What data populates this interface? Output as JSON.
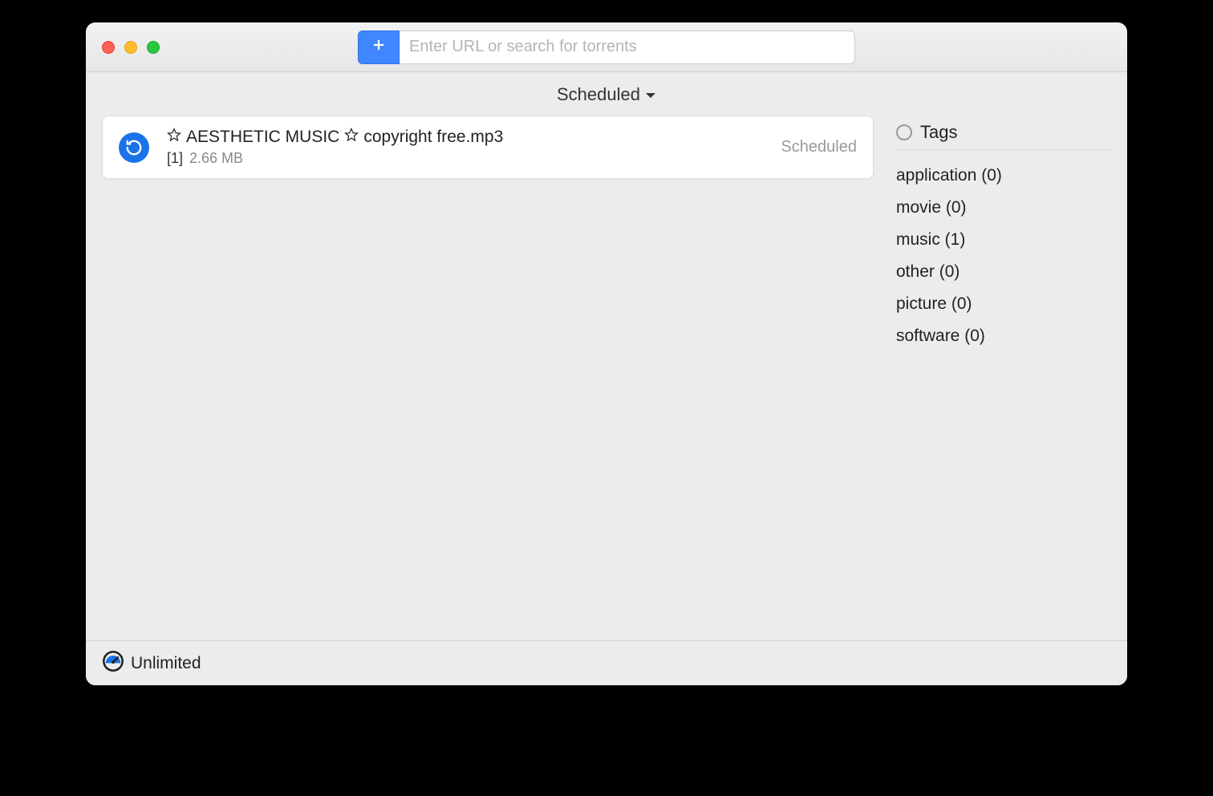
{
  "toolbar": {
    "search_placeholder": "Enter URL or search for torrents"
  },
  "filter": {
    "label": "Scheduled"
  },
  "downloads": [
    {
      "title": "AESTHETIC MUSIC",
      "title_suffix": "copyright free.mp3",
      "index_label": "[1]",
      "size": "2.66 MB",
      "status": "Scheduled"
    }
  ],
  "sidebar": {
    "header": "Tags",
    "tags": [
      {
        "label": "application (0)"
      },
      {
        "label": "movie (0)"
      },
      {
        "label": "music (1)"
      },
      {
        "label": "other (0)"
      },
      {
        "label": "picture (0)"
      },
      {
        "label": "software (0)"
      }
    ]
  },
  "footer": {
    "speed_label": "Unlimited"
  }
}
